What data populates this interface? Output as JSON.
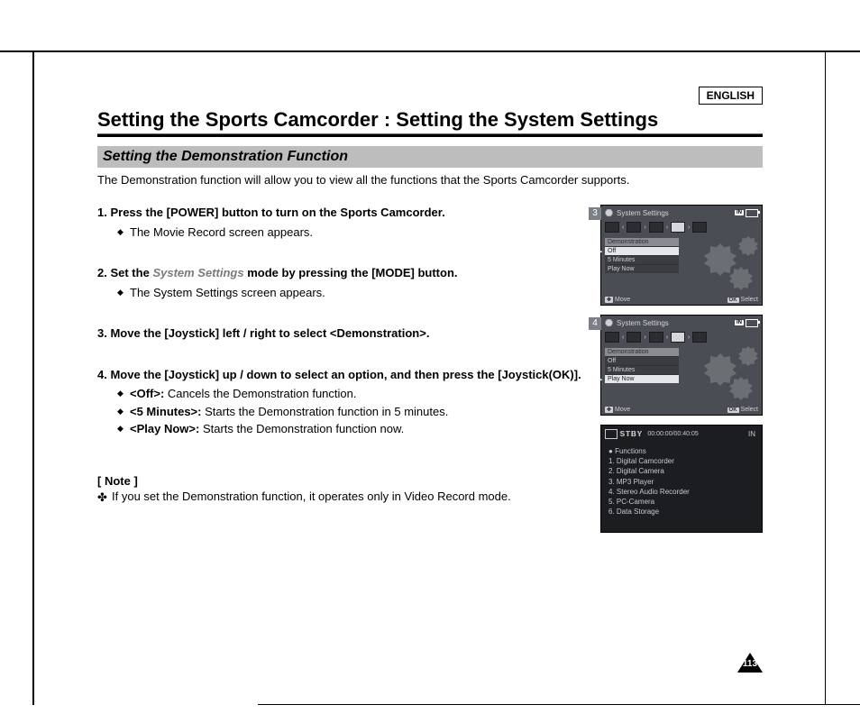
{
  "header": {
    "language": "ENGLISH",
    "title": "Setting the Sports Camcorder : Setting the System Settings",
    "subtitle": "Setting the Demonstration Function"
  },
  "intro": "The Demonstration function will allow you to view all the functions that the Sports Camcorder supports.",
  "steps": [
    {
      "num": "1.",
      "title": "Press the [POWER] button to turn on the Sports Camcorder.",
      "subs": [
        "The Movie Record screen appears."
      ]
    },
    {
      "num": "2.",
      "title_pre": "Set the",
      "title_em": "System Settings",
      "title_post": "mode by pressing the [MODE] button.",
      "subs": [
        "The System Settings screen appears."
      ]
    },
    {
      "num": "3.",
      "title": "Move the [Joystick] left / right to select <Demonstration>."
    },
    {
      "num": "4.",
      "title": "Move the [Joystick] up / down to select an option, and then press the [Joystick(OK)].",
      "subs": [
        {
          "label": "<Off>:",
          "desc": "Cancels the Demonstration function."
        },
        {
          "label": "<5 Minutes>:",
          "desc": "Starts the Demonstration function in 5 minutes."
        },
        {
          "label": "<Play Now>:",
          "desc": "Starts the Demonstration function now."
        }
      ]
    }
  ],
  "note": {
    "heading": "[ Note ]",
    "text": "If you set the Demonstration function, it operates only in Video Record mode."
  },
  "screens": [
    {
      "tag": "3",
      "title": "System Settings",
      "mem": "IN",
      "menu_header": "Demonstration",
      "rows": [
        "Off",
        "5 Minutes",
        "Play Now"
      ],
      "hint_move": "Move",
      "ok": "OK",
      "hint_select": "Select"
    },
    {
      "tag": "4",
      "title": "System Settings",
      "mem": "IN",
      "menu_header": "Demonstration",
      "rows": [
        "Off",
        "5 Minutes",
        "Play Now"
      ],
      "hint_move": "Move",
      "ok": "OK",
      "hint_select": "Select"
    },
    {
      "status": "STBY",
      "timecode": "00:00:00/00:40:05",
      "mem": "IN",
      "list_title": "Functions",
      "items": [
        "1. Digital Camcorder",
        "2. Digital Camera",
        "3. MP3 Player",
        "4. Stereo Audio Recorder",
        "5. PC-Camera",
        "6. Data Storage"
      ]
    }
  ],
  "page_number": "113"
}
